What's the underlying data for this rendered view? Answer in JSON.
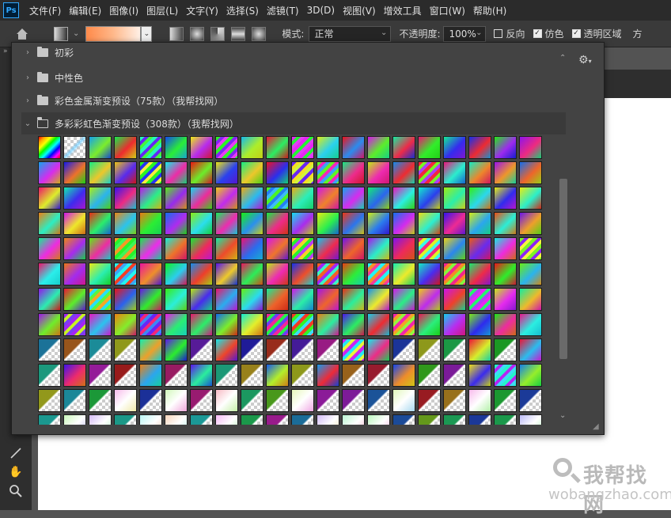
{
  "app": {
    "logo": "Ps"
  },
  "menu": [
    "文件(F)",
    "编辑(E)",
    "图像(I)",
    "图层(L)",
    "文字(Y)",
    "选择(S)",
    "滤镜(T)",
    "3D(D)",
    "视图(V)",
    "增效工具",
    "窗口(W)",
    "帮助(H)"
  ],
  "options": {
    "mode_label": "模式:",
    "mode_value": "正常",
    "opacity_label": "不透明度:",
    "opacity_value": "100%",
    "reverse_label": "反向",
    "dither_label": "仿色",
    "transparency_label": "透明区域",
    "extra": "方"
  },
  "panel": {
    "folders": [
      {
        "name": "初彩",
        "expanded": false
      },
      {
        "name": "中性色",
        "expanded": false
      },
      {
        "name": "彩色金属渐变预设（75款）（我帮找网）",
        "expanded": false
      },
      {
        "name": "多彩彩虹色渐变预设（308款）（我帮找网）",
        "expanded": true
      }
    ]
  },
  "watermark": {
    "title": "我帮找网",
    "url": "wobangzhao.com"
  },
  "colors": {
    "accent": "#31a8ff",
    "panel_bg": "#434343",
    "menubar_bg": "#2b2b2b"
  }
}
